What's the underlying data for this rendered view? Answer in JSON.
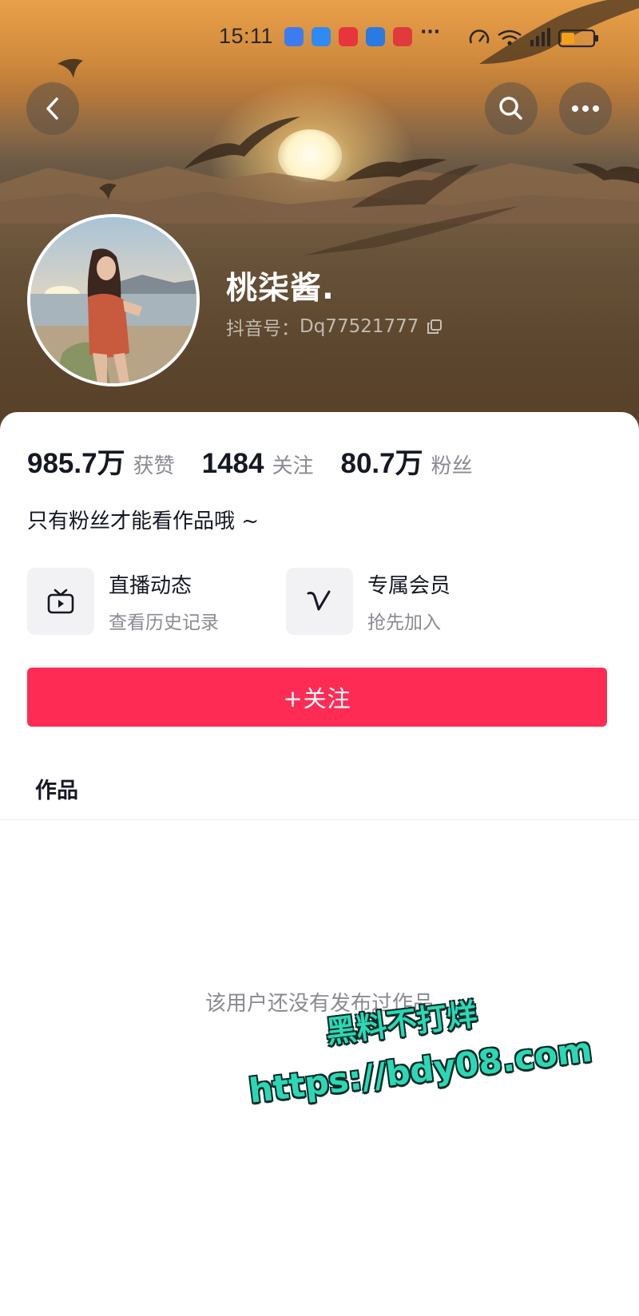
{
  "status_bar": {
    "time": "15:11",
    "more": "···",
    "notification_icons": [
      "hotspot-icon",
      "message-icon",
      "app-icon",
      "browser-icon",
      "app-icon"
    ]
  },
  "nav": {
    "back": "back-icon",
    "search": "search-icon",
    "more": "more-icon"
  },
  "profile": {
    "nickname": "桃柒酱.",
    "id_label": "抖音号：",
    "id_value": "Dq77521777"
  },
  "stats": [
    {
      "value": "985.7万",
      "label": "获赞"
    },
    {
      "value": "1484",
      "label": "关注"
    },
    {
      "value": "80.7万",
      "label": "粉丝"
    }
  ],
  "bio": "只有粉丝才能看作品哦 ~",
  "features": [
    {
      "title": "直播动态",
      "subtitle": "查看历史记录",
      "icon": "tv-icon"
    },
    {
      "title": "专属会员",
      "subtitle": "抢先加入",
      "icon": "v-badge-icon"
    }
  ],
  "follow_button": "+关注",
  "tabs": {
    "works": "作品"
  },
  "empty_state": "该用户还没有发布过作品",
  "watermark": {
    "line1": "黑料不打烊",
    "line2": "https://bdy08.com"
  },
  "colors": {
    "accent": "#fe2c55",
    "watermark": "#2bd8b6"
  }
}
